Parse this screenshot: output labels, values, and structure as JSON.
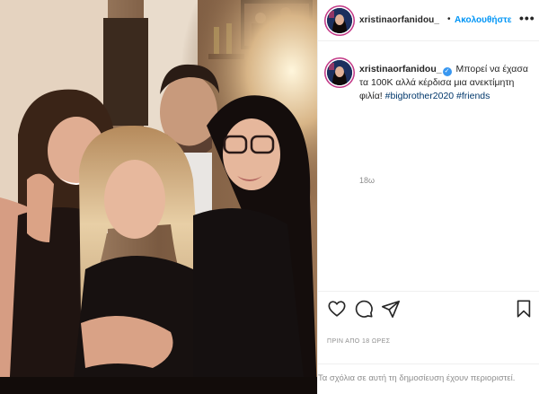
{
  "post": {
    "username": "xristinaorfanidou_",
    "follow_label": "Ακολουθήστε",
    "separator": "•",
    "more_label": "•••",
    "caption": {
      "text": "Μπορεί να έχασα τα 100Κ αλλά κέρδισα μια ανεκτίμητη φιλία!",
      "hashtags": [
        "#bigbrother2020",
        "#friends"
      ]
    },
    "relative_time": "18ω",
    "date_label": "ΠΡΙΝ ΑΠΟ 18 ΩΡΕΣ",
    "comments_notice": "Τα σχόλια σε αυτή τη δημοσίευση έχουν περιοριστεί."
  },
  "icons": {
    "verified": "verified-badge-icon",
    "like": "heart-icon",
    "comment": "comment-bubble-icon",
    "share": "paper-plane-icon",
    "save": "bookmark-icon"
  },
  "colors": {
    "link_blue": "#0095f6",
    "verified_blue": "#3897f0",
    "hashtag": "#00376b",
    "muted": "#8e8e8e",
    "avatar_ring": "#c13584"
  }
}
